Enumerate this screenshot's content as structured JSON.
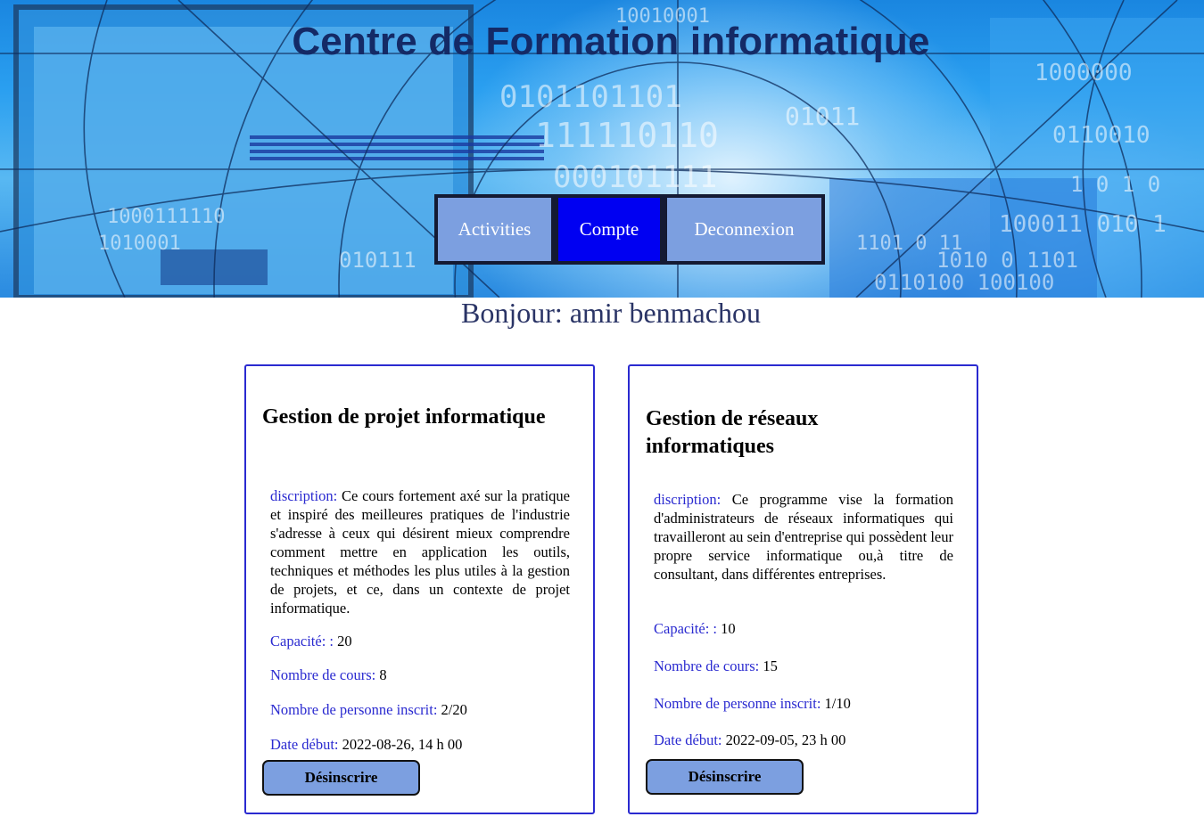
{
  "header": {
    "title": "Centre de Formation informatique"
  },
  "nav": {
    "activities": "Activities",
    "compte": "Compte",
    "deconnexion": "Deconnexion"
  },
  "greeting": {
    "label": "Bonjour:",
    "user": "amir benmachou"
  },
  "labels": {
    "description": "discription:",
    "capacity": "Capacité: :",
    "courses": "Nombre de cours:",
    "enrolled": "Nombre de personne inscrit:",
    "start_date": "Date début:",
    "unsubscribe": "Désinscrire"
  },
  "courses": [
    {
      "title": "Gestion de projet informatique",
      "description": "Ce cours fortement axé sur la pratique et inspiré des meilleures pratiques de l'industrie s'adresse à ceux qui désirent mieux comprendre comment mettre en application les outils, techniques et méthodes les plus utiles à la gestion de projets, et ce, dans un contexte de projet informatique.",
      "capacity": "20",
      "courses_count": "8",
      "enrolled": "2/20",
      "start_date": "2022-08-26, 14 h 00"
    },
    {
      "title": "Gestion de réseaux informatiques",
      "description": "Ce programme vise la formation d'administrateurs de réseaux informatiques qui travailleront au sein d'entreprise qui possèdent leur propre service informatique ou,à titre de consultant, dans différentes entreprises.",
      "capacity": "10",
      "courses_count": "15",
      "enrolled": "1/10",
      "start_date": "2022-09-05, 23 h 00"
    }
  ],
  "colors": {
    "nav_button": "#7c9fe0",
    "nav_active": "#0000f2",
    "label_blue": "#2a2ad0",
    "title_navy": "#142a66"
  }
}
